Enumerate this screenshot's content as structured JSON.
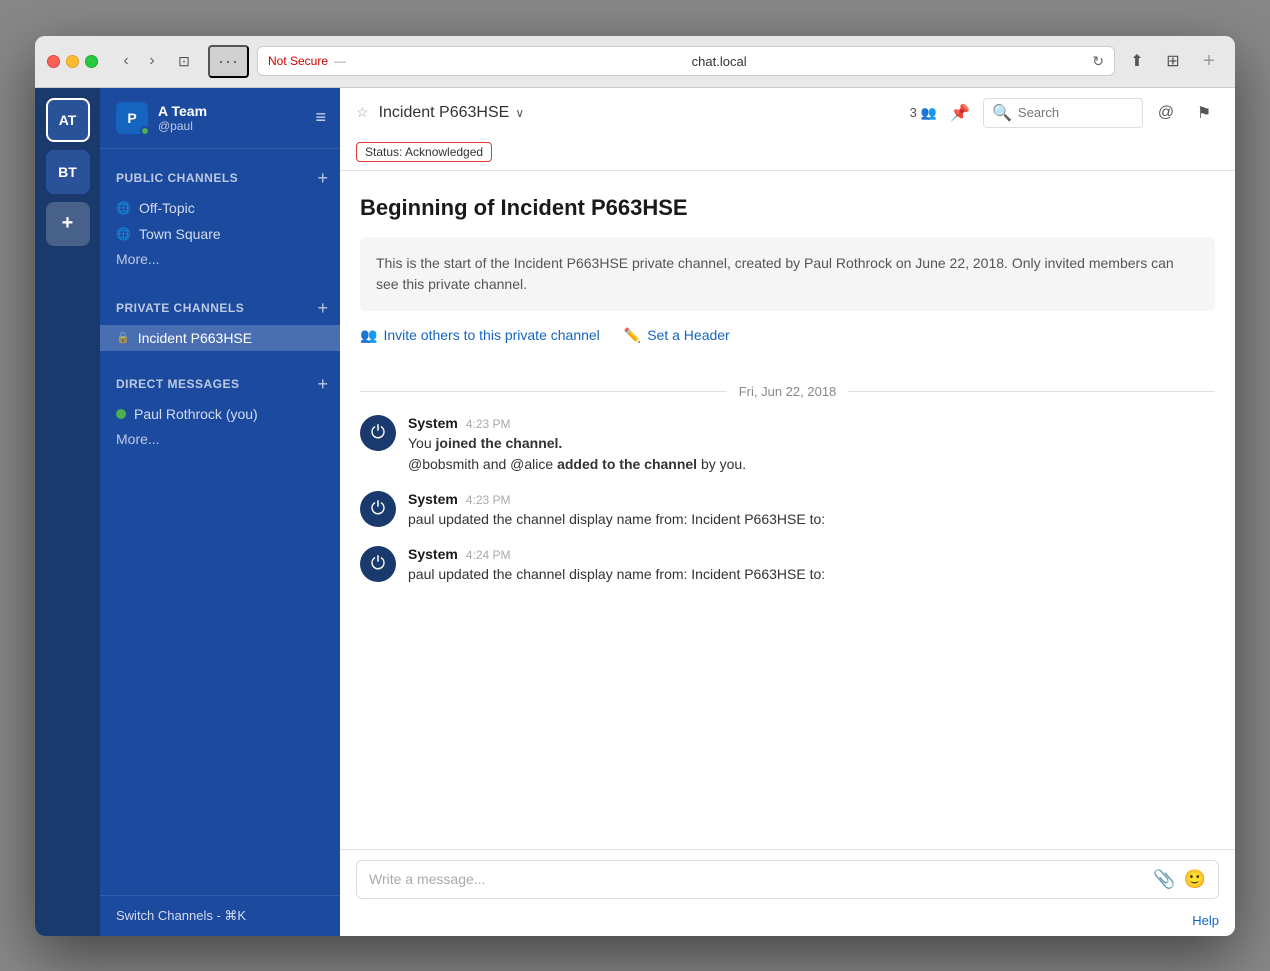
{
  "window": {
    "title": "chat.local",
    "url_not_secure": "Not Secure",
    "url_separator": "—",
    "url_domain": "chat.local"
  },
  "team_sidebar": {
    "teams": [
      {
        "label": "AT",
        "active": true
      },
      {
        "label": "BT",
        "active": false
      }
    ],
    "add_label": "+"
  },
  "channel_sidebar": {
    "team_name": "A Team",
    "username": "@paul",
    "avatar_letter": "P",
    "hamburger_label": "≡",
    "public_channels_label": "PUBLIC CHANNELS",
    "public_channels_add": "+",
    "public_channels": [
      {
        "name": "Off-Topic",
        "icon": "🌐"
      },
      {
        "name": "Town Square",
        "icon": "🌐"
      }
    ],
    "public_more": "More...",
    "private_channels_label": "PRIVATE CHANNELS",
    "private_channels_add": "+",
    "private_channels": [
      {
        "name": "Incident P663HSE",
        "active": true
      }
    ],
    "direct_messages_label": "DIRECT MESSAGES",
    "direct_messages_add": "+",
    "direct_messages": [
      {
        "name": "Paul Rothrock (you)",
        "online": true
      }
    ],
    "direct_more": "More...",
    "switch_channels": "Switch Channels - ⌘K"
  },
  "chat_header": {
    "star_icon": "☆",
    "channel_name": "Incident P663HSE",
    "chevron_icon": "∨",
    "member_count": "3",
    "status_badge": "Status: Acknowledged",
    "search_placeholder": "Search"
  },
  "chat_main": {
    "beginning_title": "Beginning of Incident P663HSE",
    "channel_info": "This is the start of the Incident P663HSE private channel, created by Paul Rothrock on June 22, 2018. Only invited members can see this private channel.",
    "invite_link": "Invite others to this private channel",
    "set_header_link": "Set a Header",
    "date_divider": "Fri, Jun 22, 2018",
    "messages": [
      {
        "author": "System",
        "time": "4:23 PM",
        "lines": [
          {
            "text": "You ",
            "bold_part": "joined the channel.",
            "bold": true,
            "suffix": ""
          },
          {
            "text": "@bobsmith and @alice ",
            "bold_part": "added to the channel",
            "bold": true,
            "suffix": " by you."
          }
        ]
      },
      {
        "author": "System",
        "time": "4:23 PM",
        "lines": [
          {
            "text": "paul updated the channel display name from: Incident P663HSE to:"
          }
        ]
      },
      {
        "author": "System",
        "time": "4:24 PM",
        "lines": [
          {
            "text": "paul updated the channel display name from: Incident P663HSE to:"
          }
        ]
      }
    ]
  },
  "message_input": {
    "placeholder": "Write a message..."
  },
  "footer": {
    "help_label": "Help"
  }
}
